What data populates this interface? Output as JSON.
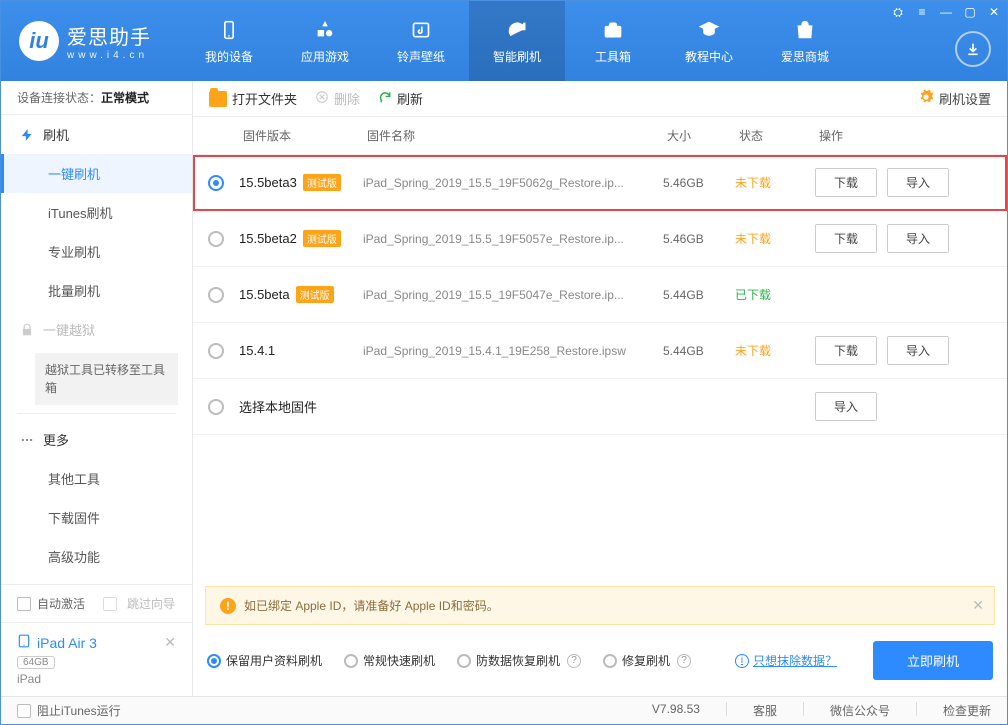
{
  "app": {
    "name": "爱思助手",
    "site": "www.i4.cn"
  },
  "nav": [
    {
      "label": "我的设备",
      "icon": "device"
    },
    {
      "label": "应用游戏",
      "icon": "apps"
    },
    {
      "label": "铃声壁纸",
      "icon": "media"
    },
    {
      "label": "智能刷机",
      "icon": "flash",
      "active": true
    },
    {
      "label": "工具箱",
      "icon": "toolbox"
    },
    {
      "label": "教程中心",
      "icon": "tutorial"
    },
    {
      "label": "爱思商城",
      "icon": "store"
    }
  ],
  "connection": {
    "prefix": "设备连接状态：",
    "mode": "正常模式"
  },
  "sidebar": {
    "group_flash": "刷机",
    "items_flash": [
      "一键刷机",
      "iTunes刷机",
      "专业刷机",
      "批量刷机"
    ],
    "jailbreak": "一键越狱",
    "jailbreak_note": "越狱工具已转移至工具箱",
    "group_more": "更多",
    "items_more": [
      "其他工具",
      "下载固件",
      "高级功能"
    ]
  },
  "auto": {
    "activate": "自动激活",
    "jump": "跳过向导"
  },
  "device": {
    "name": "iPad Air 3",
    "capacity": "64GB",
    "type": "iPad"
  },
  "toolbar": {
    "open": "打开文件夹",
    "delete": "删除",
    "refresh": "刷新",
    "settings": "刷机设置"
  },
  "columns": {
    "ver": "固件版本",
    "name": "固件名称",
    "size": "大小",
    "status": "状态",
    "ops": "操作"
  },
  "buttons": {
    "download": "下载",
    "import": "导入"
  },
  "status_labels": {
    "not": "未下载",
    "done": "已下载"
  },
  "badge_beta": "测试版",
  "rows": [
    {
      "sel": true,
      "ver": "15.5beta3",
      "beta": true,
      "file": "iPad_Spring_2019_15.5_19F5062g_Restore.ip...",
      "size": "5.46GB",
      "status": "not",
      "dl": true,
      "imp": true,
      "hl": true
    },
    {
      "sel": false,
      "ver": "15.5beta2",
      "beta": true,
      "file": "iPad_Spring_2019_15.5_19F5057e_Restore.ip...",
      "size": "5.46GB",
      "status": "not",
      "dl": true,
      "imp": true
    },
    {
      "sel": false,
      "ver": "15.5beta",
      "beta": true,
      "file": "iPad_Spring_2019_15.5_19F5047e_Restore.ip...",
      "size": "5.44GB",
      "status": "done",
      "dl": false,
      "imp": false
    },
    {
      "sel": false,
      "ver": "15.4.1",
      "beta": false,
      "file": "iPad_Spring_2019_15.4.1_19E258_Restore.ipsw",
      "size": "5.44GB",
      "status": "not",
      "dl": true,
      "imp": true
    },
    {
      "sel": false,
      "ver": "选择本地固件",
      "beta": false,
      "file": "",
      "size": "",
      "status": "",
      "dl": false,
      "imp": true
    }
  ],
  "warn": "如已绑定 Apple ID，请准备好 Apple ID和密码。",
  "options": {
    "keep": "保留用户资料刷机",
    "fast": "常规快速刷机",
    "antidata": "防数据恢复刷机",
    "repair": "修复刷机",
    "erase": "只想抹除数据？",
    "go": "立即刷机"
  },
  "statusbar": {
    "block_itunes": "阻止iTunes运行",
    "version": "V7.98.53",
    "links": [
      "客服",
      "微信公众号",
      "检查更新"
    ]
  }
}
